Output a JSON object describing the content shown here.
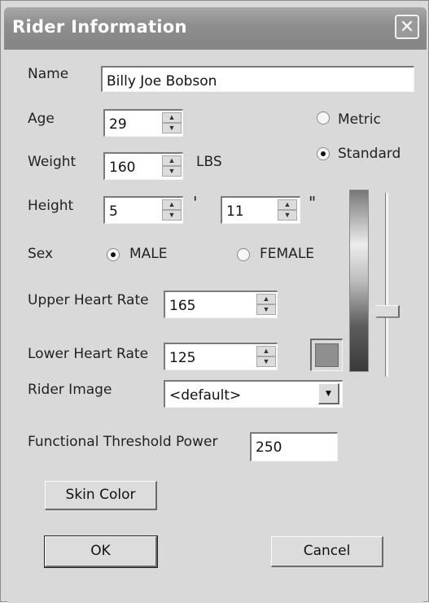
{
  "window": {
    "title": "Rider Information",
    "close_glyph": "✕"
  },
  "form": {
    "name_label": "Name",
    "name_value": "Billy Joe Bobson",
    "age_label": "Age",
    "age_value": "29",
    "weight_label": "Weight",
    "weight_value": "160",
    "weight_unit": "LBS",
    "height_label": "Height",
    "height_feet": "5",
    "feet_mark": "'",
    "height_inches": "11",
    "inches_mark": "\"",
    "sex_label": "Sex",
    "sex_male": "MALE",
    "sex_female": "FEMALE",
    "sex_selected": "MALE",
    "units_metric": "Metric",
    "units_standard": "Standard",
    "units_selected": "Standard",
    "upper_hr_label": "Upper Heart Rate",
    "upper_hr_value": "165",
    "lower_hr_label": "Lower Heart Rate",
    "lower_hr_value": "125",
    "rider_image_label": "Rider Image",
    "rider_image_value": "<default>",
    "ftp_label": "Functional Threshold Power",
    "ftp_value": "250"
  },
  "skin_color": {
    "slider_level": 0.25,
    "swatch_color": "#8f8f8f"
  },
  "buttons": {
    "skin_color": "Skin Color",
    "ok": "OK",
    "cancel": "Cancel"
  },
  "icons": {
    "spin_up": "▲",
    "spin_down": "▼",
    "dropdown": "▼"
  }
}
